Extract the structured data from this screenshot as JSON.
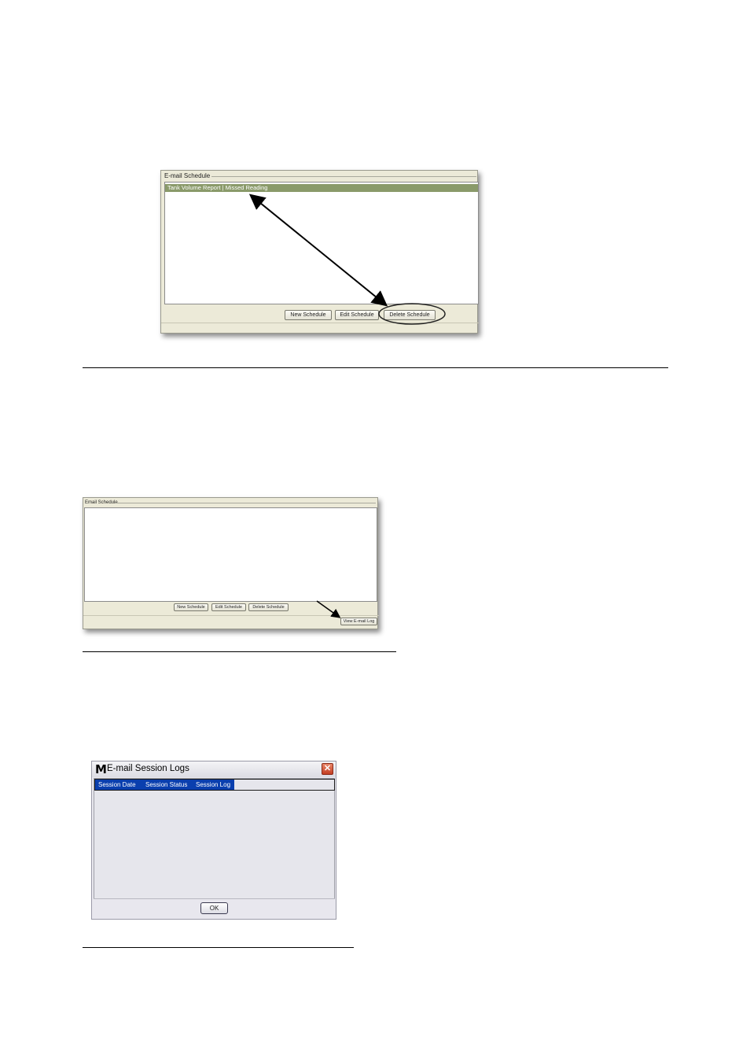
{
  "figure1": {
    "group_label": "E-mail Schedule",
    "selected_item": "Tank Volume Report | Missed Reading",
    "buttons": [
      "New Schedule",
      "Edit Schedule",
      "Delete Schedule"
    ]
  },
  "figure2": {
    "group_label": "Email Schedule",
    "buttons": [
      "New Schedule",
      "Edit Schedule",
      "Delete Schedule"
    ],
    "view_log_label": "View E-mail Log"
  },
  "figure3": {
    "app_icon_letter": "M",
    "window_title": "E-mail Session Logs",
    "close_glyph": "✕",
    "columns": [
      "Session Date",
      "Session Status",
      "Session Log"
    ],
    "ok_label": "OK"
  }
}
